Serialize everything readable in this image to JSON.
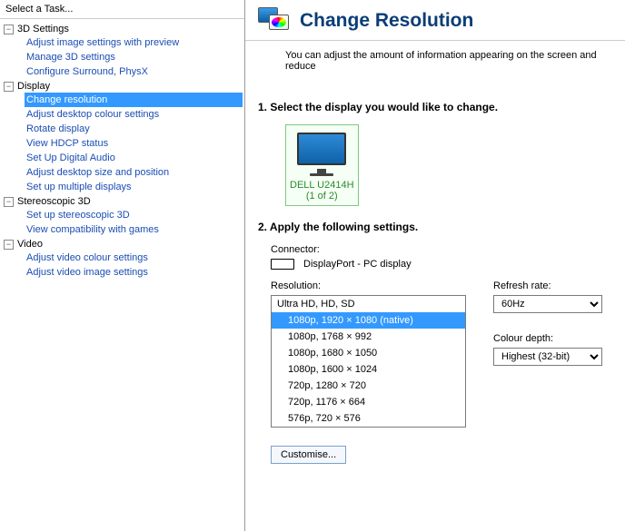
{
  "sidebar": {
    "title": "Select a Task...",
    "groups": [
      {
        "label": "3D Settings",
        "expanded": true,
        "items": [
          "Adjust image settings with preview",
          "Manage 3D settings",
          "Configure Surround, PhysX"
        ]
      },
      {
        "label": "Display",
        "expanded": true,
        "items": [
          "Change resolution",
          "Adjust desktop colour settings",
          "Rotate display",
          "View HDCP status",
          "Set Up Digital Audio",
          "Adjust desktop size and position",
          "Set up multiple displays"
        ],
        "selectedIndex": 0
      },
      {
        "label": "Stereoscopic 3D",
        "expanded": true,
        "items": [
          "Set up stereoscopic 3D",
          "View compatibility with games"
        ]
      },
      {
        "label": "Video",
        "expanded": true,
        "items": [
          "Adjust video colour settings",
          "Adjust video image settings"
        ]
      }
    ]
  },
  "page": {
    "title": "Change Resolution",
    "subtitle": "You can adjust the amount of information appearing on the screen and reduce",
    "step1": "1. Select the display you would like to change.",
    "display": {
      "name": "DELL U2414H",
      "count": "(1 of 2)"
    },
    "step2": "2. Apply the following settings.",
    "connectorLabel": "Connector:",
    "connectorValue": "DisplayPort - PC display",
    "resolutionLabel": "Resolution:",
    "resolutionGroup": "Ultra HD, HD, SD",
    "resolutions": [
      "1080p, 1920 × 1080 (native)",
      "1080p, 1768 × 992",
      "1080p, 1680 × 1050",
      "1080p, 1600 × 1024",
      "720p, 1280 × 720",
      "720p, 1176 × 664",
      "576p, 720 × 576"
    ],
    "resolutionSelectedIndex": 0,
    "refreshLabel": "Refresh rate:",
    "refreshValue": "60Hz",
    "depthLabel": "Colour depth:",
    "depthValue": "Highest (32-bit)",
    "customise": "Customise..."
  }
}
